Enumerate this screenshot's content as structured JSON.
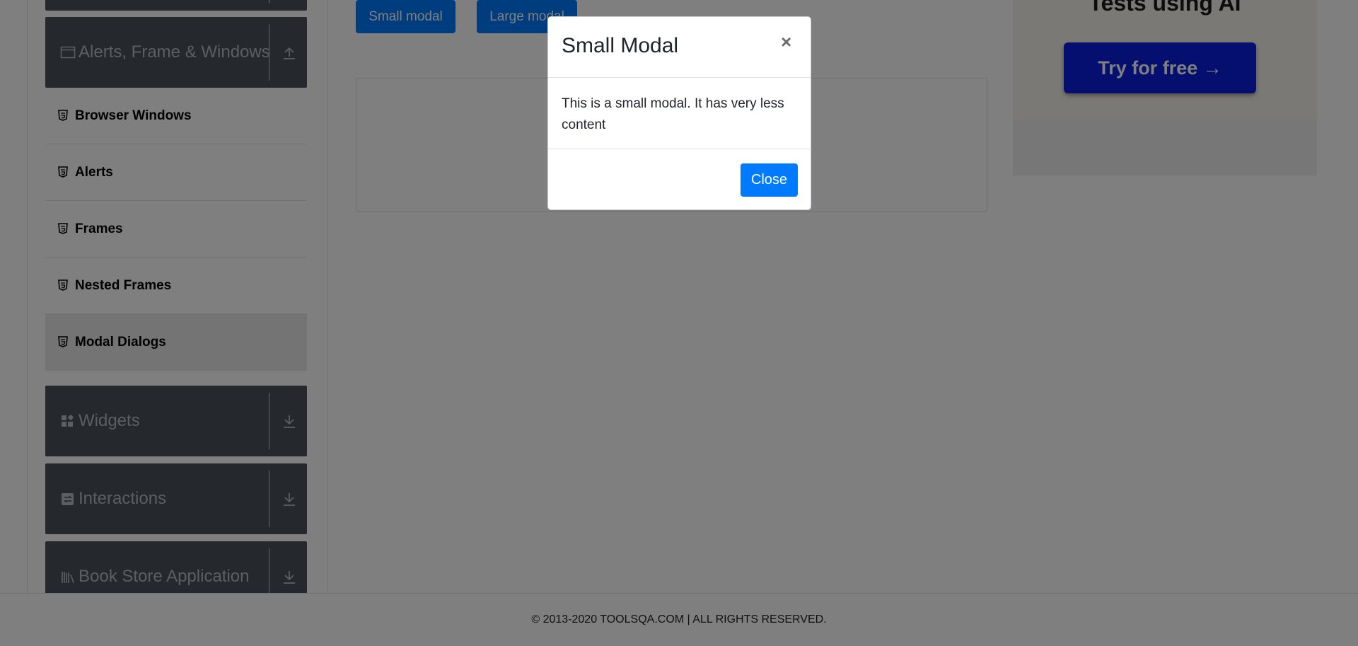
{
  "sidebar": {
    "alerts_group": {
      "label": "Alerts, Frame & Windows",
      "icon": "window-icon",
      "arrow": "collapse-up-icon"
    },
    "items": [
      {
        "label": "Browser Windows",
        "icon": "html5-icon"
      },
      {
        "label": "Alerts",
        "icon": "html5-icon"
      },
      {
        "label": "Frames",
        "icon": "html5-icon"
      },
      {
        "label": "Nested Frames",
        "icon": "html5-icon"
      },
      {
        "label": "Modal Dialogs",
        "icon": "html5-icon",
        "active": true
      }
    ],
    "widgets_group": {
      "label": "Widgets",
      "icon": "widgets-icon",
      "arrow": "expand-down-icon"
    },
    "interactions_group": {
      "label": "Interactions",
      "icon": "interactions-icon",
      "arrow": "expand-down-icon"
    },
    "bookstore_group": {
      "label": "Book Store Application",
      "icon": "bookstore-icon",
      "arrow": "expand-down-icon"
    }
  },
  "main": {
    "small_modal_button": "Small modal",
    "large_modal_button": "Large modal"
  },
  "ad": {
    "headline": "Tests using AI",
    "cta": "Try for free →"
  },
  "footer": {
    "copyright": "© 2013-2020 TOOLSQA.COM | ALL RIGHTS RESERVED."
  },
  "modal": {
    "title": "Small Modal",
    "close_symbol": "×",
    "body": "This is a small modal. It has very less content",
    "close_button": "Close"
  },
  "colors": {
    "primary": "#007bff",
    "sidebar_header": "#4b525b",
    "overlay": "rgba(0,0,0,0.5)",
    "ad_cta": "#0a1fe0"
  }
}
